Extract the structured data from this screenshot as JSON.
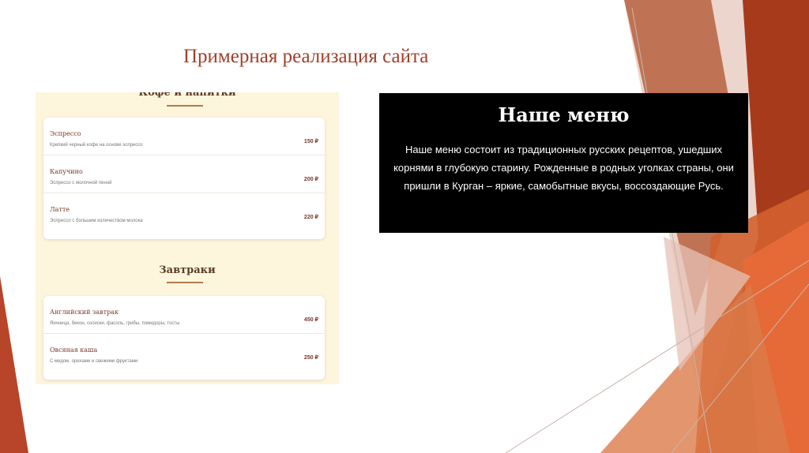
{
  "slide": {
    "title": "Примерная реализация сайта"
  },
  "site": {
    "categories": [
      {
        "title": "Кофе и напитки",
        "items": [
          {
            "name": "Эспрессо",
            "description": "Крепкий черный кофе на основе эспрессо",
            "price": "150 ₽"
          },
          {
            "name": "Капучино",
            "description": "Эспрессо с молочной пеной",
            "price": "200 ₽"
          },
          {
            "name": "Латте",
            "description": "Эспрессо с большим количеством молока",
            "price": "220 ₽"
          }
        ]
      },
      {
        "title": "Завтраки",
        "items": [
          {
            "name": "Английский завтрак",
            "description": "Яичница, бекон, сосиски, фасоль, грибы, помидоры, тосты",
            "price": "450 ₽"
          },
          {
            "name": "Овсяная каша",
            "description": "С медом, орехами и свежими фруктами",
            "price": "250 ₽"
          }
        ]
      }
    ]
  },
  "menu_panel": {
    "heading": "Наше меню",
    "text": "Наше меню состоит из традиционных русских рецептов, ушедших корнями в глубокую старину. Рожденные в родных уголках страны, они пришли в Курган – яркие, самобытные вкусы, воссоздающие Русь."
  },
  "colors": {
    "title": "#a0402a",
    "accent_dark": "#a33a1e",
    "accent_orange": "#d9633a",
    "site_background": "#fdf6dd",
    "panel_background": "#000000"
  }
}
